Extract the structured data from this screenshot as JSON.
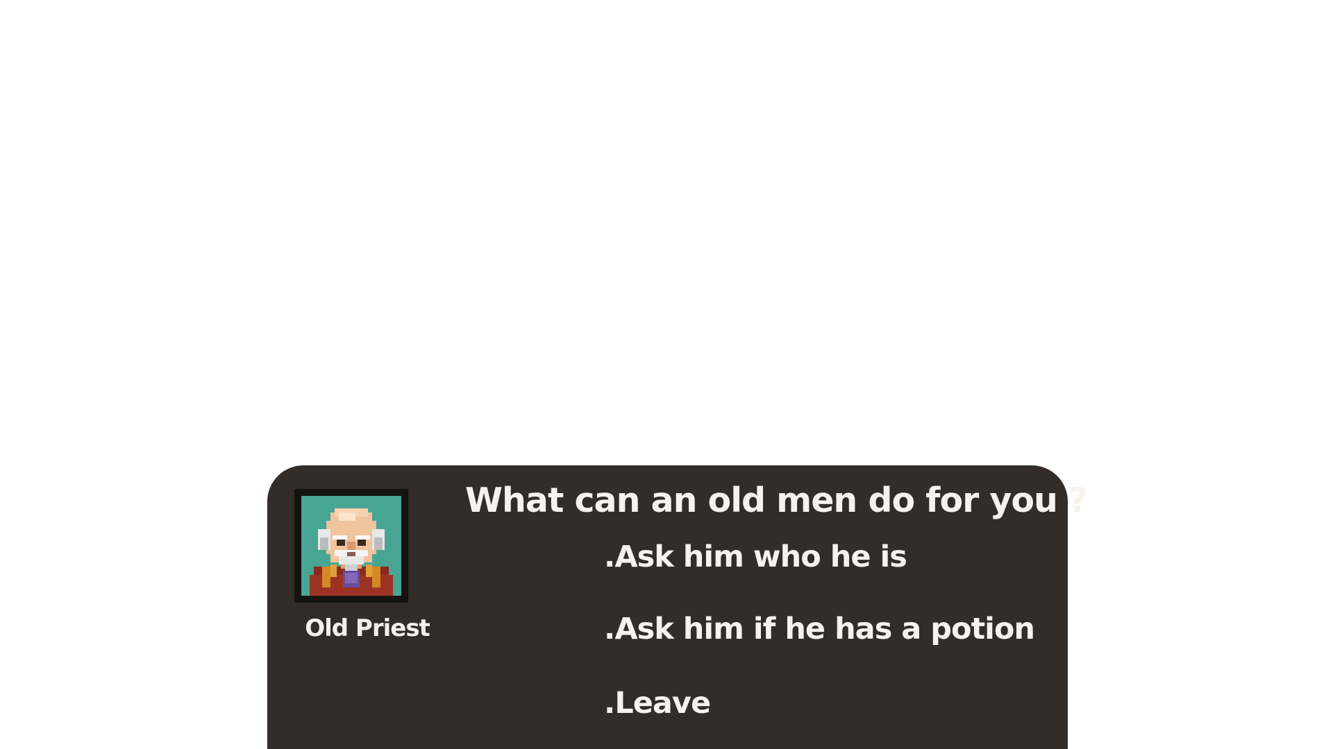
{
  "npc": {
    "name": "Old Priest",
    "portrait_icon": "old-priest-portrait"
  },
  "dialog": {
    "prompt": "What can an old men do for you ?",
    "choices": [
      {
        "label": ".Ask him who he is"
      },
      {
        "label": ".Ask him if he has a potion"
      },
      {
        "label": ".Leave"
      }
    ]
  },
  "colors": {
    "background": "#ffffff",
    "panel": "#332c29",
    "portrait_frame": "#151312",
    "portrait_bg": "#48a593",
    "text": "#f6f2ec"
  }
}
